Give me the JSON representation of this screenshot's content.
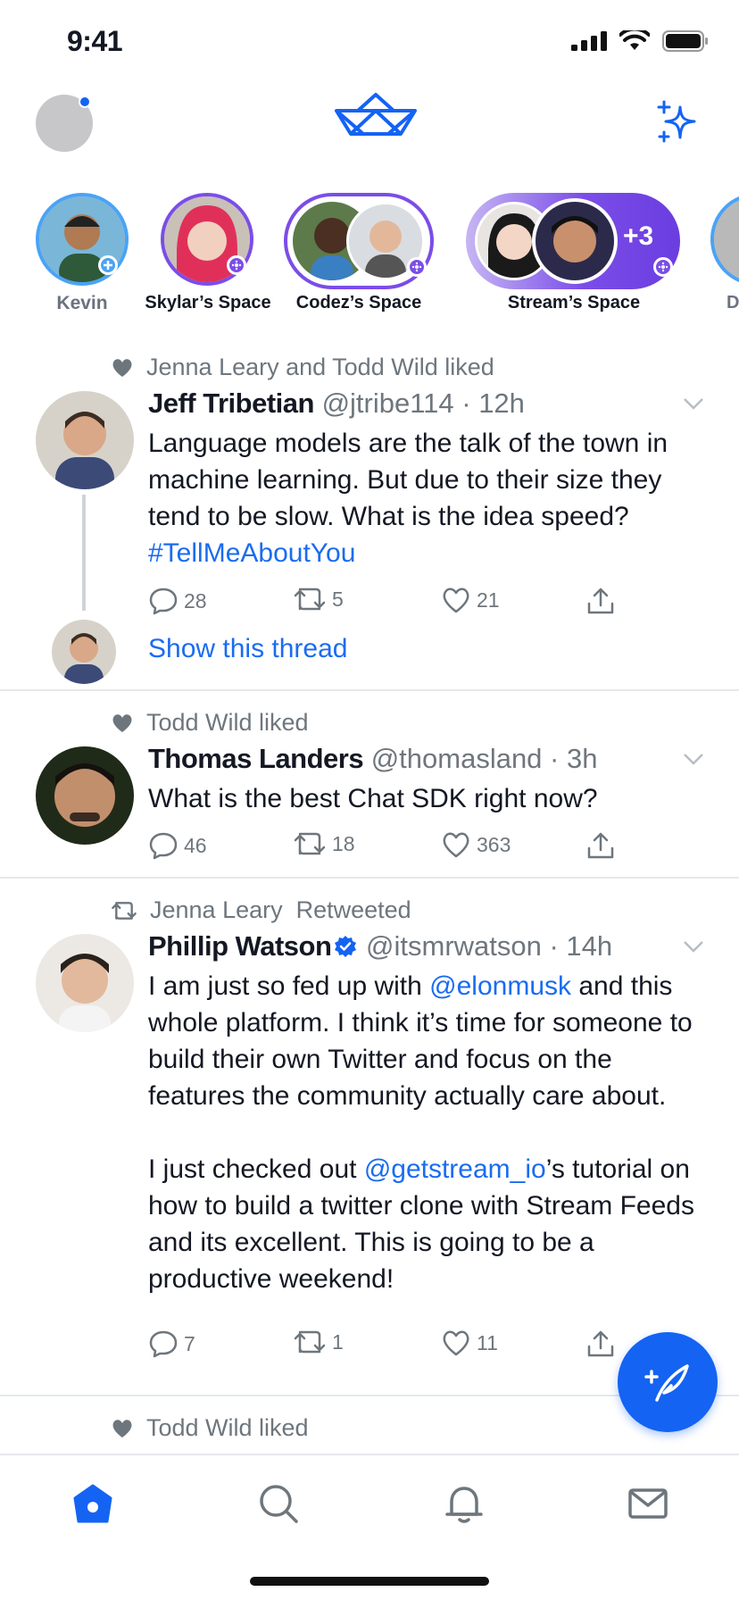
{
  "status_bar": {
    "time": "9:41"
  },
  "colors": {
    "accent": "#1463f3",
    "link": "#1a6cf0",
    "purple": "#7b4de8",
    "secondary_text": "#6e767d"
  },
  "spaces": [
    {
      "label": "Kevin"
    },
    {
      "label": "Skylar’s Space"
    },
    {
      "label": "Codez’s Space"
    },
    {
      "label": "Stream’s Space",
      "extra": "+3"
    },
    {
      "label": "D"
    }
  ],
  "tweets": [
    {
      "context": "Jenna Leary and Todd Wild liked",
      "name": "Jeff Tribetian",
      "handle": "@jtribe114 · 12h",
      "body_parts": [
        "Language models are the talk of the town in machine learning. But due to their size they tend to be slow. What is the idea speed? ",
        "#TellMeAboutYou"
      ],
      "replies": "28",
      "retweets": "5",
      "likes": "21",
      "show_thread": "Show this thread"
    },
    {
      "context": "Todd Wild liked",
      "name": "Thomas Landers",
      "handle": "@thomasland · 3h",
      "body": "What is the best Chat SDK right now?",
      "replies": "46",
      "retweets": "18",
      "likes": "363"
    },
    {
      "context": "Jenna Leary  Retweeted",
      "name": "Phillip Watson",
      "handle": "@itsmrwatson · 14h",
      "body_parts": [
        "I am just so fed up with ",
        "@elonmusk",
        " and this whole platform. I think it’s time for someone to build their own Twitter and focus on the features the community actually care about.",
        "I just checked out ",
        "@getstream_io",
        "’s tutorial on how to build a twitter clone with Stream Feeds and its excellent. This is going to be a productive weekend!"
      ],
      "replies": "7",
      "retweets": "1",
      "likes": "11"
    },
    {
      "context": "Todd Wild liked"
    }
  ]
}
